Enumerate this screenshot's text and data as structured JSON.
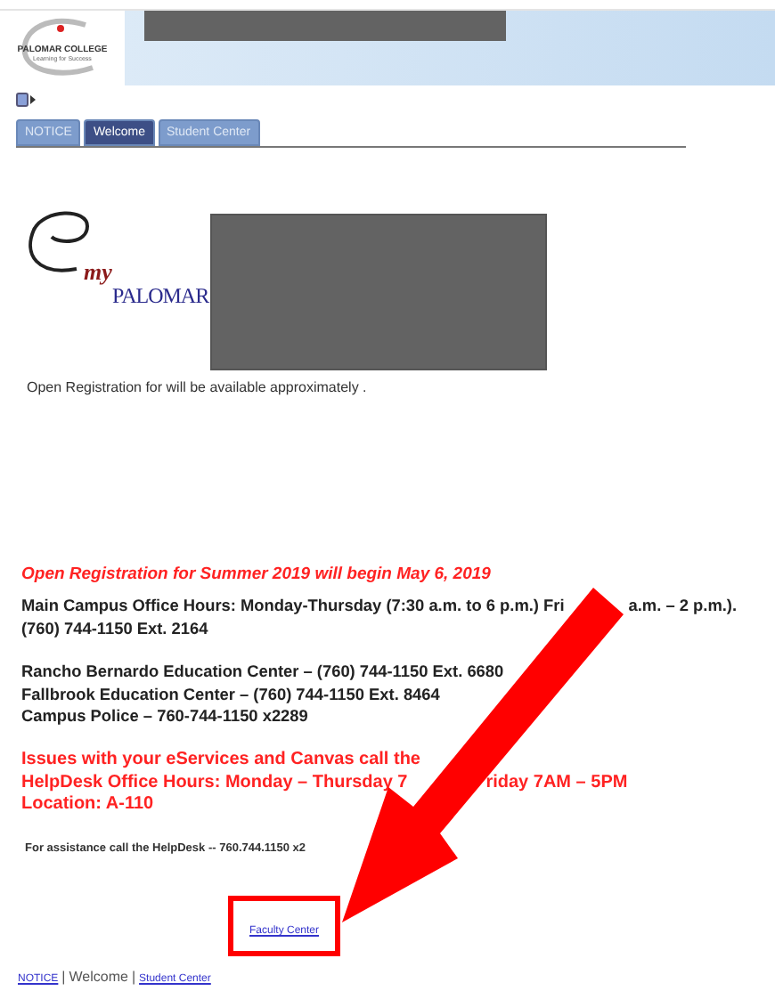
{
  "header": {
    "logo_name": "PALOMAR COLLEGE",
    "logo_tagline": "Learning for Success"
  },
  "tabs": [
    {
      "label": "NOTICE",
      "selected": false
    },
    {
      "label": "Welcome",
      "selected": true
    },
    {
      "label": "Student Center",
      "selected": false
    }
  ],
  "welcome": {
    "logo_my": "my",
    "logo_name": "PALOMAR",
    "notice": "Open Registration for will be available approximately ."
  },
  "announcement": {
    "headline": "Open Registration for Summer 2019 will begin May 6, 2019",
    "groups": [
      [
        {
          "kind": "plain",
          "parts": [
            "Main Campus Office Hours: Monday-Thursday (7:30 a.m. to 6 p.m.) Fri",
            "a.m. – 2 p.m.)."
          ]
        },
        {
          "kind": "plain",
          "parts": [
            "(760) 744-1150 Ext. 2164"
          ]
        }
      ],
      [
        {
          "kind": "plain",
          "parts": [
            "Rancho Bernardo Education Center – (760) 744-1150 Ext. 6680"
          ]
        },
        {
          "kind": "plain",
          "parts": [
            "Fallbrook Education Center – (760) 744-1150 Ext. 8464"
          ]
        },
        {
          "kind": "plain",
          "parts": [
            "Campus Police – 760-744-1150 x2289"
          ]
        }
      ],
      [
        {
          "kind": "alert",
          "parts": [
            "Issues with your eServices and Canvas call the"
          ]
        },
        {
          "kind": "alert",
          "parts": [
            "HelpDesk Office Hours: Monday – Thursday 7",
            "riday 7AM – 5PM"
          ]
        },
        {
          "kind": "alert",
          "parts": [
            "Location: A-110"
          ]
        }
      ],
      [
        {
          "kind": "small",
          "parts": [
            "For assistance call the HelpDesk -- 760.744.1150 x2"
          ]
        }
      ]
    ]
  },
  "faculty_link": "Faculty Center",
  "footer": [
    {
      "label": "NOTICE",
      "link": true
    },
    {
      "label": "Welcome",
      "link": false
    },
    {
      "label": "Student Center",
      "link": true
    }
  ],
  "footer_separator": "|"
}
